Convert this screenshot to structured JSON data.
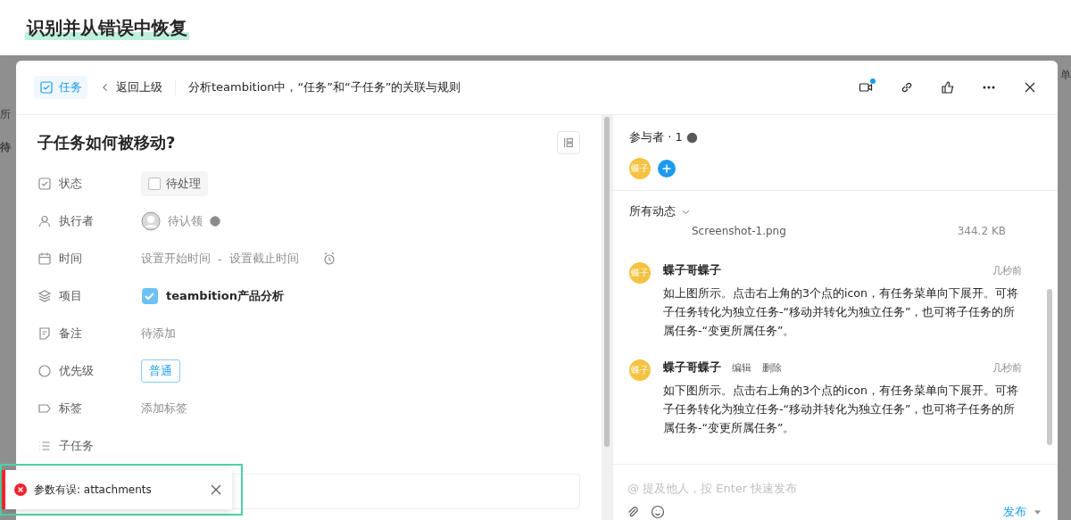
{
  "page_title": "识别并从错误中恢复",
  "background": {
    "left_fragments": [
      "所",
      "待"
    ],
    "right_fragments": [
      "单"
    ]
  },
  "header": {
    "tag": "任务",
    "back": "返回上级",
    "breadcrumb": "分析teambition中，“任务”和“子任务”的关联与规则",
    "video_notice": true
  },
  "task": {
    "title": "子任务如何被移动?",
    "fields": [
      {
        "kind": "status",
        "label": "状态",
        "value": "待处理",
        "checked": false
      },
      {
        "kind": "assignee",
        "label": "执行者",
        "value": "待认领"
      },
      {
        "kind": "time",
        "label": "时间",
        "start": "设置开始时间",
        "separator": "-",
        "end": "设置截止时间"
      },
      {
        "kind": "project",
        "label": "项目",
        "value": "teambition产品分析"
      },
      {
        "kind": "note",
        "label": "备注",
        "value": "待添加"
      },
      {
        "kind": "priority",
        "label": "优先级",
        "value": "普通"
      },
      {
        "kind": "tags",
        "label": "标签",
        "value": "添加标签"
      },
      {
        "kind": "subtasks",
        "label": "子任务"
      }
    ]
  },
  "participants": {
    "label": "参与者 · 1",
    "members": [
      {
        "initials": "蝶子",
        "color": "#f5c342"
      }
    ]
  },
  "activity": {
    "filter": "所有动态",
    "attachment": {
      "name": "Screenshot-1.png",
      "size": "344.2 KB"
    },
    "comments": [
      {
        "author": "蝶子哥蝶子",
        "initials": "蝶子",
        "color": "#f5c342",
        "time": "几秒前",
        "text": "如上图所示。点击右上角的3个点的icon，有任务菜单向下展开。可将子任务转化为独立任务-“移动并转化为独立任务”，也可将子任务的所属任务-“变更所属任务”。"
      },
      {
        "author": "蝶子哥蝶子",
        "initials": "蝶子",
        "color": "#f5c342",
        "actions": [
          "编辑",
          "删除"
        ],
        "time": "几秒前",
        "text": "如下图所示。点击右上角的3个点的icon，有任务菜单向下展开。可将子任务转化为独立任务-“移动并转化为独立任务”，也可将子任务的所属任务-“变更所属任务”。"
      }
    ]
  },
  "composer": {
    "placeholder": "@ 提及他人，按 Enter 快速发布",
    "submit": "发布"
  },
  "toast": {
    "message": "参数有误: attachments"
  }
}
